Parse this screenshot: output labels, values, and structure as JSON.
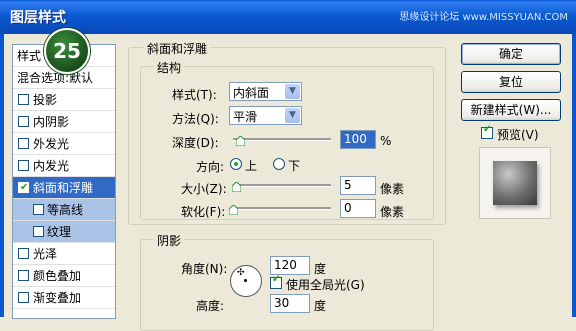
{
  "window": {
    "title": "图层样式",
    "watermark": "思缘设计论坛 www.MISSYUAN.COM"
  },
  "badge": "25",
  "left_panel": {
    "header": "样式",
    "blend_options": "混合选项:默认",
    "items": [
      {
        "label": "投影",
        "checked": false,
        "state": "normal"
      },
      {
        "label": "内阴影",
        "checked": false,
        "state": "normal"
      },
      {
        "label": "外发光",
        "checked": false,
        "state": "normal"
      },
      {
        "label": "内发光",
        "checked": false,
        "state": "normal"
      },
      {
        "label": "斜面和浮雕",
        "checked": true,
        "state": "selected"
      },
      {
        "label": "等高线",
        "checked": false,
        "state": "sub"
      },
      {
        "label": "纹理",
        "checked": false,
        "state": "sub"
      },
      {
        "label": "光泽",
        "checked": false,
        "state": "normal"
      },
      {
        "label": "颜色叠加",
        "checked": false,
        "state": "normal"
      },
      {
        "label": "渐变叠加",
        "checked": false,
        "state": "normal"
      }
    ]
  },
  "bevel": {
    "section_title": "斜面和浮雕",
    "structure_title": "结构",
    "style_label": "样式(T):",
    "style_value": "内斜面",
    "technique_label": "方法(Q):",
    "technique_value": "平滑",
    "depth_label": "深度(D):",
    "depth_value": "100",
    "depth_unit": "%",
    "direction_label": "方向:",
    "direction_up": "上",
    "direction_down": "下",
    "direction_selected": "上",
    "size_label": "大小(Z):",
    "size_value": "5",
    "size_unit": "像素",
    "soften_label": "软化(F):",
    "soften_value": "0",
    "soften_unit": "像素"
  },
  "shading": {
    "title": "阴影",
    "angle_label": "角度(N):",
    "angle_value": "120",
    "angle_unit": "度",
    "global_light_label": "使用全局光(G)",
    "global_light_checked": true,
    "altitude_label": "高度:",
    "altitude_value": "30",
    "altitude_unit": "度"
  },
  "buttons": {
    "ok": "确定",
    "reset": "复位",
    "new_style": "新建样式(W)...",
    "preview_label": "预览(V)",
    "preview_checked": true
  },
  "colors": {
    "titlebar": "#0b5ad0",
    "selection": "#316ac5",
    "badge": "#2a6e2a"
  }
}
